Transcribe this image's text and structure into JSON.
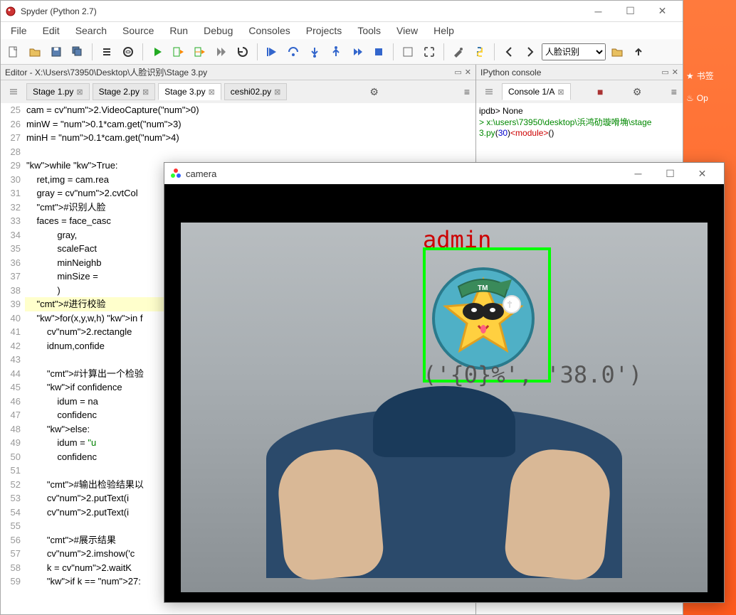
{
  "window": {
    "title": "Spyder (Python 2.7)"
  },
  "menu": [
    "File",
    "Edit",
    "Search",
    "Source",
    "Run",
    "Debug",
    "Consoles",
    "Projects",
    "Tools",
    "View",
    "Help"
  ],
  "toolbar": {
    "dropdown_selected": "人脸识别"
  },
  "editor": {
    "pane_title": "Editor - X:\\Users\\73950\\Desktop\\人脸识别\\Stage 3.py",
    "tabs": [
      {
        "label": "Stage 1.py",
        "active": false
      },
      {
        "label": "Stage 2.py",
        "active": false
      },
      {
        "label": "Stage 3.py",
        "active": true
      },
      {
        "label": "ceshi02.py",
        "active": false
      }
    ],
    "code": [
      {
        "n": 25,
        "t": "cam = cv2.VideoCapture(0)"
      },
      {
        "n": 26,
        "t": "minW = 0.1*cam.get(3)"
      },
      {
        "n": 27,
        "t": "minH = 0.1*cam.get(4)"
      },
      {
        "n": 28,
        "t": ""
      },
      {
        "n": 29,
        "t": "while True:"
      },
      {
        "n": 30,
        "t": "    ret,img = cam.rea"
      },
      {
        "n": 31,
        "t": "    gray = cv2.cvtCol"
      },
      {
        "n": 32,
        "t": "    #识别人脸"
      },
      {
        "n": 33,
        "t": "    faces = face_casc"
      },
      {
        "n": 34,
        "t": "            gray,"
      },
      {
        "n": 35,
        "t": "            scaleFact"
      },
      {
        "n": 36,
        "t": "            minNeighb"
      },
      {
        "n": 37,
        "t": "            minSize ="
      },
      {
        "n": 38,
        "t": "            )"
      },
      {
        "n": 39,
        "t": "    #进行校验",
        "hl": true
      },
      {
        "n": 40,
        "t": "    for(x,y,w,h) in f"
      },
      {
        "n": 41,
        "t": "        cv2.rectangle"
      },
      {
        "n": 42,
        "t": "        idnum,confide"
      },
      {
        "n": 43,
        "t": ""
      },
      {
        "n": 44,
        "t": "        #计算出一个检验"
      },
      {
        "n": 45,
        "t": "        if confidence"
      },
      {
        "n": 46,
        "t": "            idum = na"
      },
      {
        "n": 47,
        "t": "            confidenc"
      },
      {
        "n": 48,
        "t": "        else:"
      },
      {
        "n": 49,
        "t": "            idum = \"u"
      },
      {
        "n": 50,
        "t": "            confidenc"
      },
      {
        "n": 51,
        "t": ""
      },
      {
        "n": 52,
        "t": "        #输出检验结果以"
      },
      {
        "n": 53,
        "t": "        cv2.putText(i"
      },
      {
        "n": 54,
        "t": "        cv2.putText(i"
      },
      {
        "n": 55,
        "t": ""
      },
      {
        "n": 56,
        "t": "        #展示结果"
      },
      {
        "n": 57,
        "t": "        cv2.imshow('c"
      },
      {
        "n": 58,
        "t": "        k = cv2.waitK"
      },
      {
        "n": 59,
        "t": "        if k == 27:"
      }
    ]
  },
  "console": {
    "pane_title": "IPython console",
    "tab_label": "Console 1/A",
    "output": [
      {
        "txt": "ipdb> None",
        "cls": "c-k"
      },
      {
        "txt": "> x:\\users\\73950\\desktop\\浜鸿劯璇嗗埆\\stage",
        "cls": "c-g"
      },
      {
        "txt": "3.py(30)<module>()",
        "cls": "c-g",
        "extra": {
          "n": "30",
          "m": "<module>"
        }
      }
    ]
  },
  "camera": {
    "title": "camera",
    "label": "admin",
    "confidence": "('{0}%', '38.0')"
  },
  "right_strip": {
    "item1": "书签",
    "item2": "Op"
  }
}
